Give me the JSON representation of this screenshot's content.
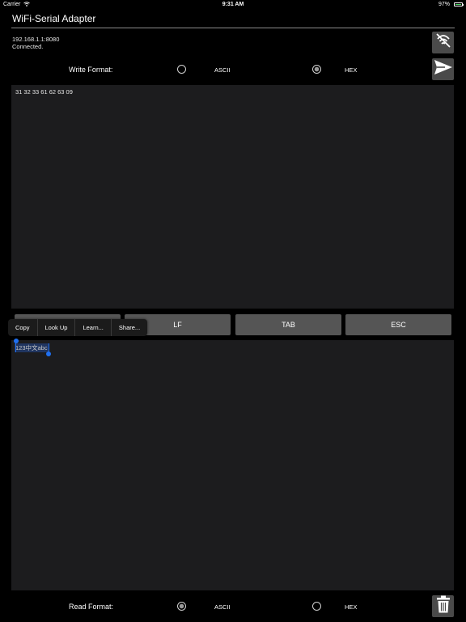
{
  "status_bar": {
    "carrier": "Carrier",
    "time": "9:31 AM",
    "battery": "97%"
  },
  "header": {
    "title": "WiFi-Serial Adapter"
  },
  "connection": {
    "address": "192.168.1.1:8080",
    "state": "Connected."
  },
  "write_format": {
    "label": "Write Format:",
    "options": [
      {
        "label": "ASCII",
        "selected": false
      },
      {
        "label": "HEX",
        "selected": true
      }
    ]
  },
  "write_area": {
    "text": "31 32 33 61 62 63 09"
  },
  "keys": {
    "lf": "LF",
    "tab": "TAB",
    "esc": "ESC"
  },
  "context_menu": {
    "items": [
      "Copy",
      "Look Up",
      "Learn...",
      "Share..."
    ]
  },
  "read_area": {
    "text": "123中文abc"
  },
  "read_format": {
    "label": "Read Format:",
    "options": [
      {
        "label": "ASCII",
        "selected": true
      },
      {
        "label": "HEX",
        "selected": false
      }
    ]
  },
  "icons": {
    "disconnect": "no-signal-icon",
    "send": "send-icon",
    "trash": "trash-icon"
  },
  "colors": {
    "background": "#000000",
    "panel": "#1c1c1e",
    "button": "#555555",
    "selection": "#1f6ff0"
  }
}
